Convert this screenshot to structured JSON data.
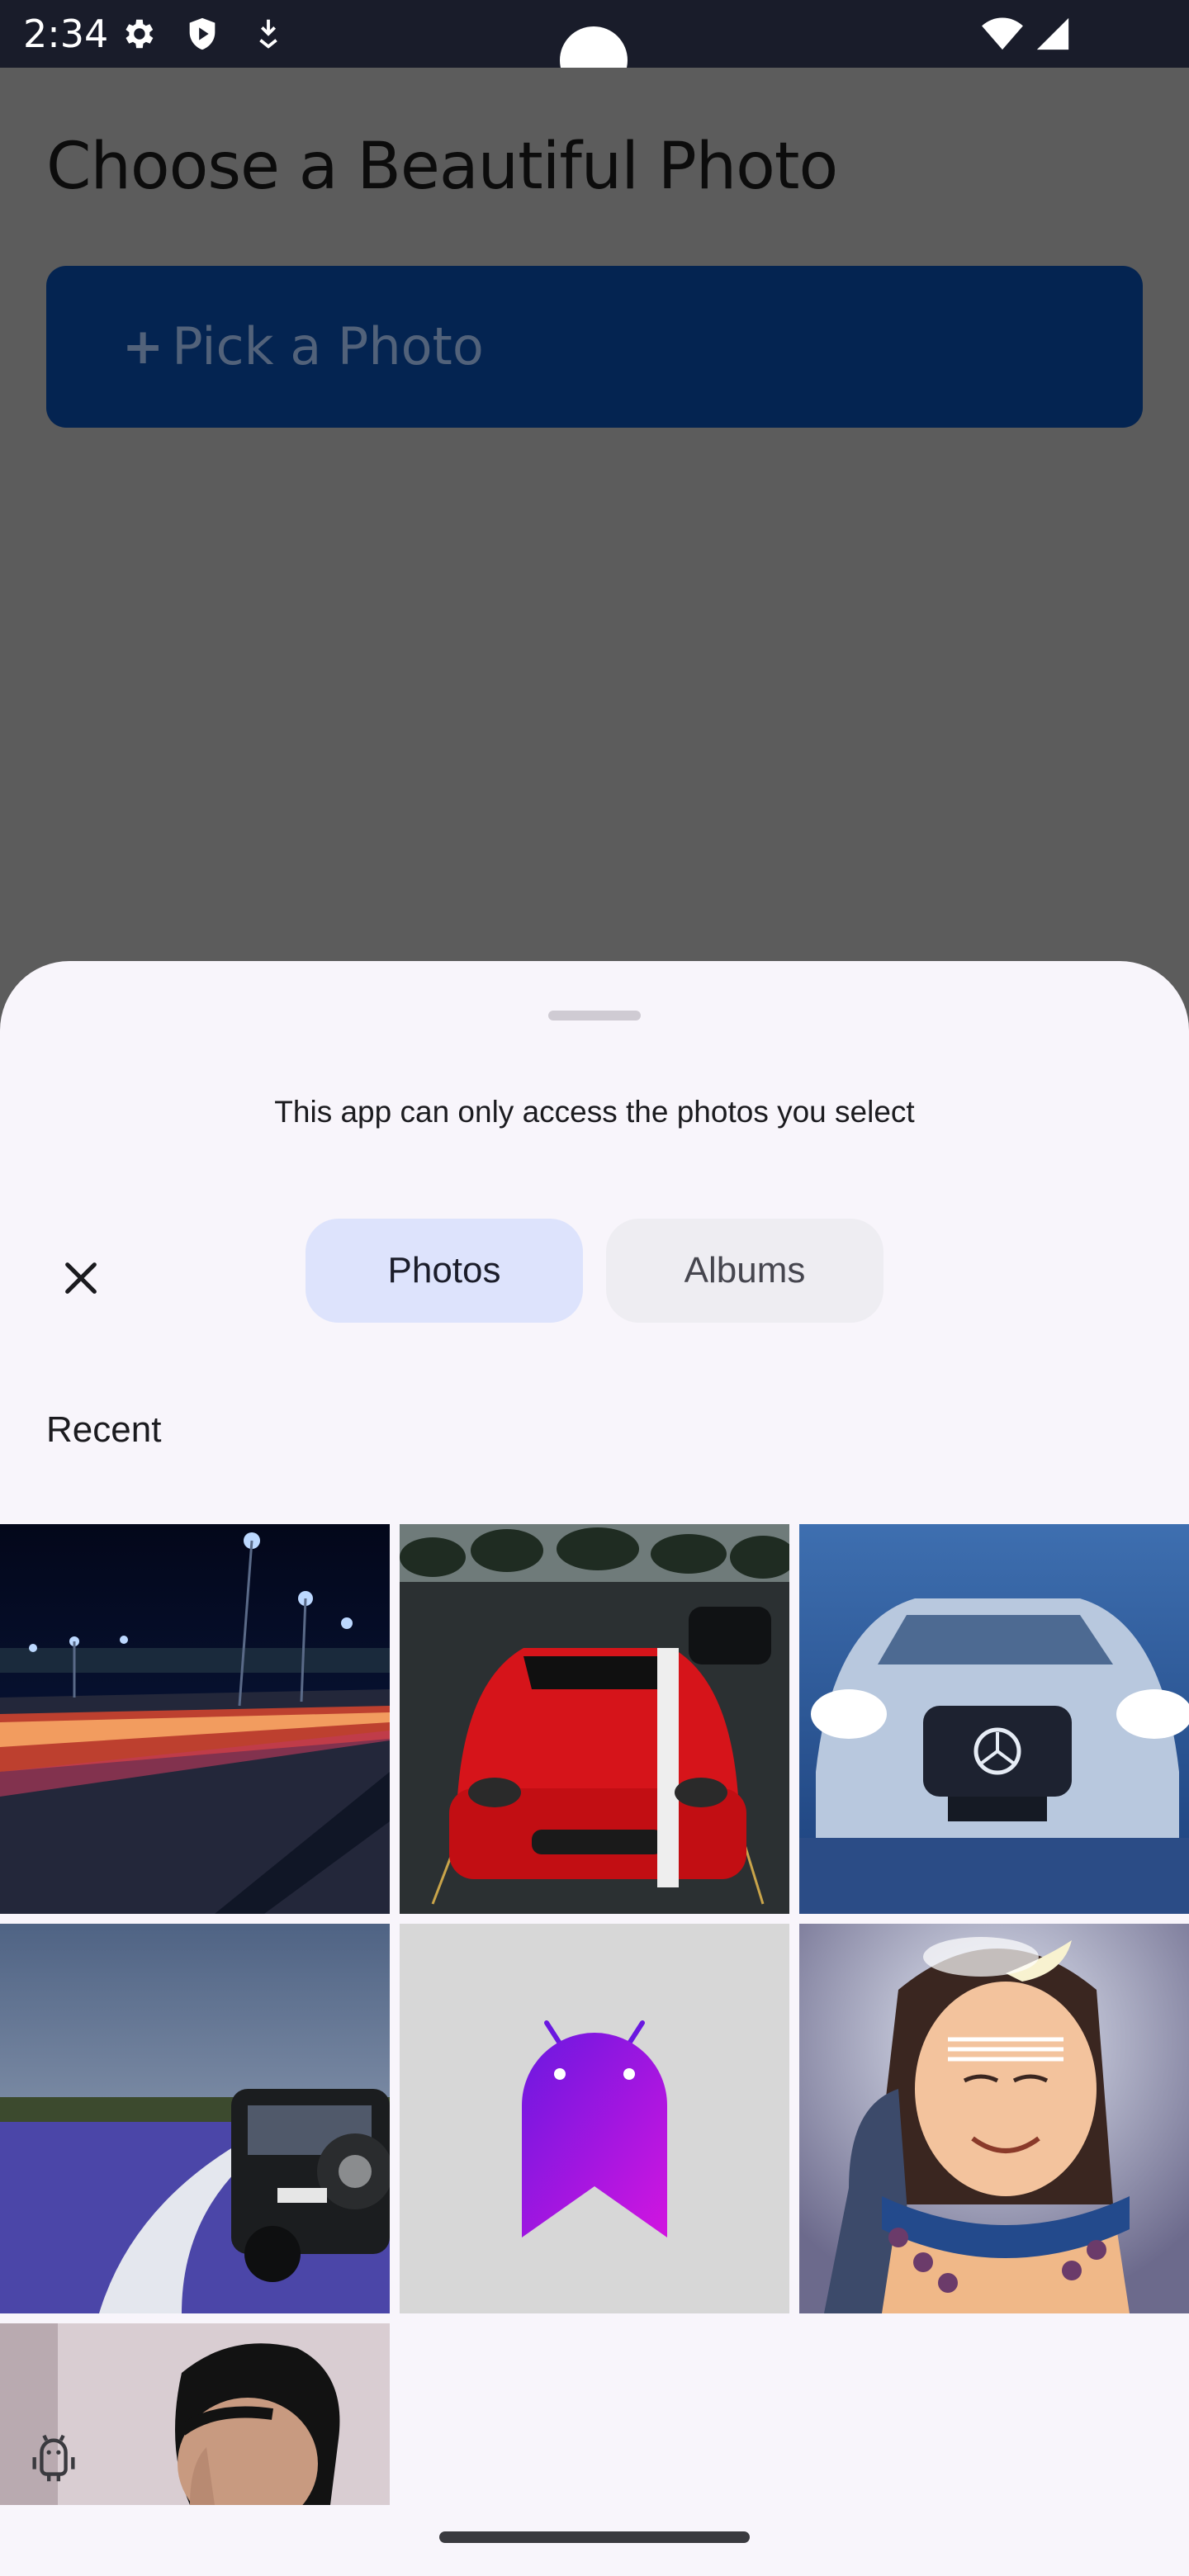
{
  "status_bar": {
    "time": "2:34",
    "icons": [
      "settings-icon",
      "shield-play-icon",
      "download-badge-icon",
      "wifi-icon",
      "cellular-signal-icon"
    ]
  },
  "app": {
    "title": "Choose a Beautiful Photo",
    "pick_button": {
      "icon": "plus-icon",
      "label": "Pick a Photo"
    },
    "colors": {
      "button_bg": "#042451",
      "scrim": "#5c5c5c"
    }
  },
  "picker_sheet": {
    "notice": "This app can only access the photos you select",
    "close_icon": "close-icon",
    "tabs": [
      {
        "label": "Photos",
        "selected": true
      },
      {
        "label": "Albums",
        "selected": false
      }
    ],
    "section_label": "Recent",
    "photos": [
      {
        "subject": "city-road-night-light-trails"
      },
      {
        "subject": "red-sports-car-parking-lot"
      },
      {
        "subject": "silver-mercedes-headlights"
      },
      {
        "subject": "offroad-vehicle-lavender-field"
      },
      {
        "subject": "android-bot-placeholder"
      },
      {
        "subject": "illustrated-shiva-portrait"
      },
      {
        "subject": "person-thinking-portrait"
      }
    ],
    "colors": {
      "sheet_bg": "#f8f5fb",
      "selected_tab_bg": "#dde3fc",
      "unselected_tab_bg": "#eeedf2"
    }
  },
  "overlay": {
    "icon": "android-debug-icon"
  }
}
